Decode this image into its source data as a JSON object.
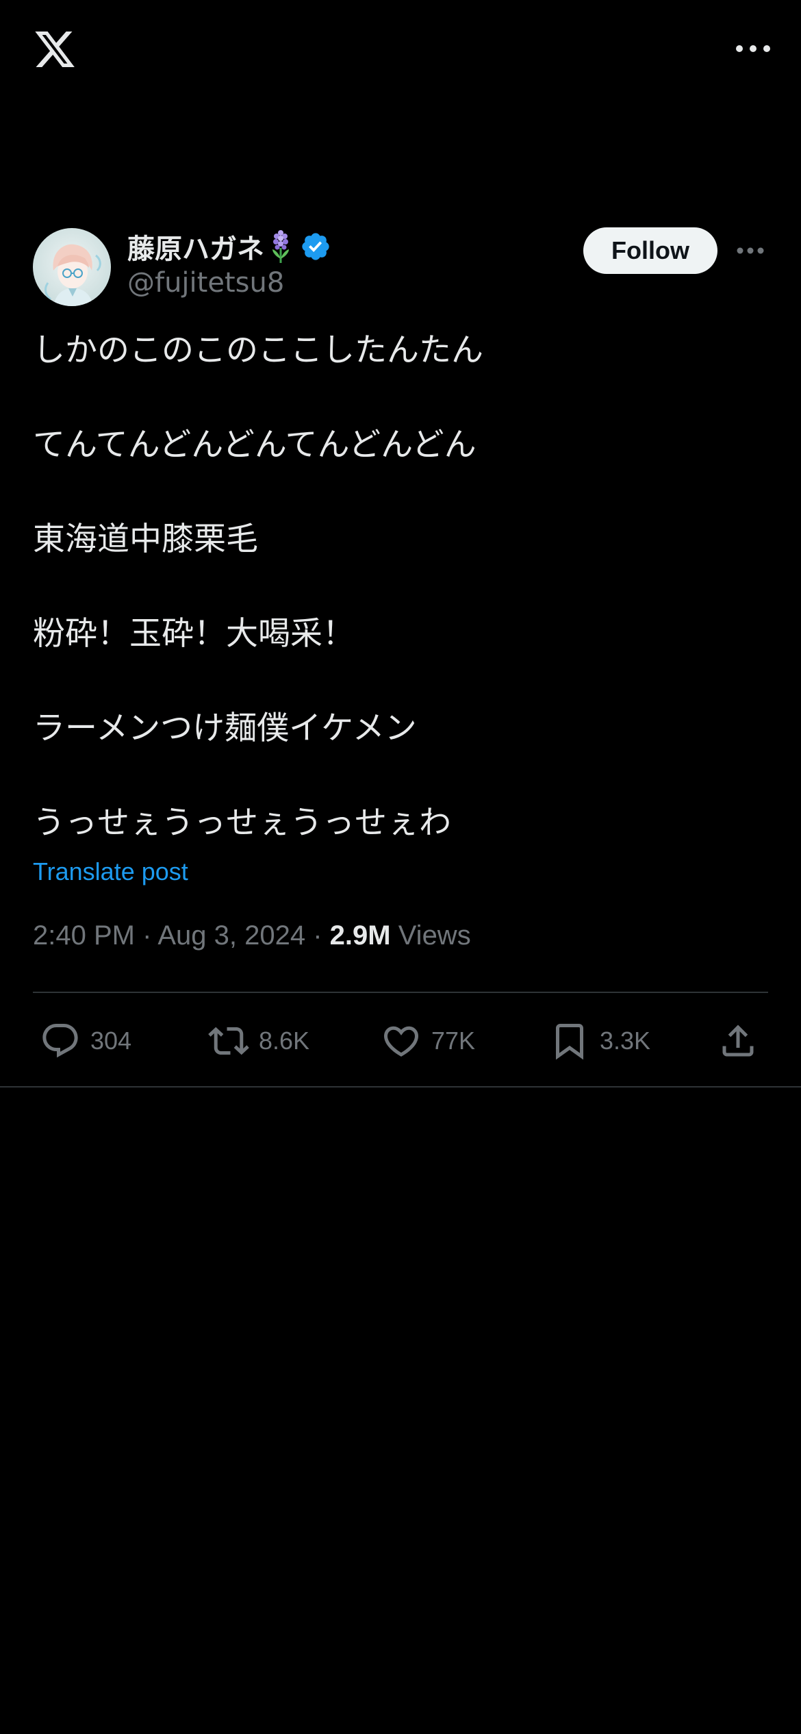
{
  "header": {
    "logo_icon": "x-logo-icon",
    "more_icon": "more-horizontal-icon"
  },
  "post": {
    "author": {
      "display_name": "藤原ハガネ",
      "handle": "@fujitetsu8",
      "verified": true,
      "emoji_icon": "hyacinth-flower-icon"
    },
    "follow_label": "Follow",
    "lines": [
      "しかのこのこのここしたんたん",
      "てんてんどんどんてんどんどん",
      "東海道中膝栗毛",
      "粉砕！玉砕！大喝采！",
      "ラーメンつけ麺僕イケメン",
      "うっせぇうっせぇうっせぇわ"
    ],
    "translate_label": "Translate post",
    "time": "2:40 PM",
    "date": "Aug 3, 2024",
    "views_count": "2.9M",
    "views_label": "Views",
    "separator": "·",
    "stats": {
      "replies": "304",
      "reposts": "8.6K",
      "likes": "77K",
      "bookmarks": "3.3K"
    }
  },
  "colors": {
    "background": "#000000",
    "text": "#e7e9ea",
    "secondary": "#71767b",
    "accent": "#1d9bf0",
    "divider": "#2f3336",
    "follow_bg": "#eff3f4"
  }
}
